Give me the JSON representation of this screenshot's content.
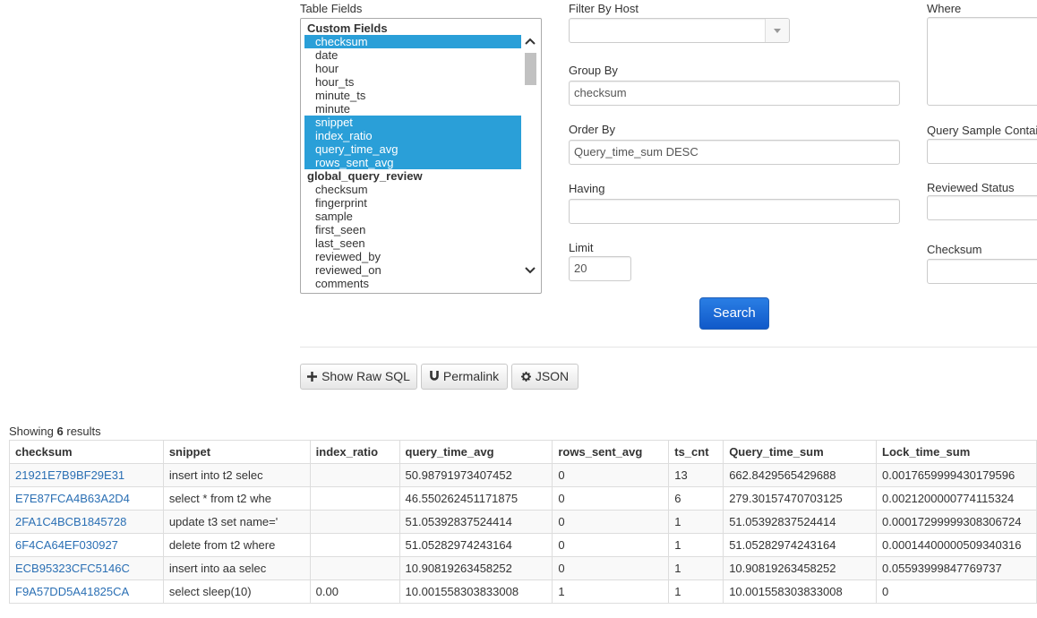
{
  "labels": {
    "table_fields": "Table Fields",
    "filter_by_host": "Filter By Host",
    "where": "Where",
    "group_by": "Group By",
    "order_by": "Order By",
    "having": "Having",
    "limit": "Limit",
    "query_sample_contains": "Query Sample Contai",
    "reviewed_status": "Reviewed Status",
    "checksum": "Checksum"
  },
  "inputs": {
    "filter_by_host": "",
    "where": "",
    "group_by": "checksum",
    "order_by": "Query_time_sum DESC",
    "having": "",
    "limit": "20",
    "query_sample_contains": "",
    "reviewed_status": "",
    "checksum": ""
  },
  "fields_list": {
    "groups": [
      {
        "name": "Custom Fields",
        "options": [
          {
            "label": "checksum",
            "selected": true
          },
          {
            "label": "date",
            "selected": false
          },
          {
            "label": "hour",
            "selected": false
          },
          {
            "label": "hour_ts",
            "selected": false
          },
          {
            "label": "minute_ts",
            "selected": false
          },
          {
            "label": "minute",
            "selected": false
          },
          {
            "label": "snippet",
            "selected": true
          },
          {
            "label": "index_ratio",
            "selected": true
          },
          {
            "label": "query_time_avg",
            "selected": true
          },
          {
            "label": "rows_sent_avg",
            "selected": true
          }
        ]
      },
      {
        "name": "global_query_review",
        "options": [
          {
            "label": "checksum",
            "selected": false
          },
          {
            "label": "fingerprint",
            "selected": false
          },
          {
            "label": "sample",
            "selected": false
          },
          {
            "label": "first_seen",
            "selected": false
          },
          {
            "label": "last_seen",
            "selected": false
          },
          {
            "label": "reviewed_by",
            "selected": false
          },
          {
            "label": "reviewed_on",
            "selected": false
          },
          {
            "label": "comments",
            "selected": false
          }
        ]
      }
    ]
  },
  "buttons": {
    "search": "Search",
    "show_raw_sql": "Show Raw SQL",
    "permalink": "Permalink",
    "json": "JSON"
  },
  "results": {
    "showing_prefix": "Showing",
    "count": "6",
    "showing_suffix": "results",
    "columns": [
      "checksum",
      "snippet",
      "index_ratio",
      "query_time_avg",
      "rows_sent_avg",
      "ts_cnt",
      "Query_time_sum",
      "Lock_time_sum"
    ],
    "rows": [
      [
        "21921E7B9BF29E31",
        "insert into t2 selec",
        "",
        "50.98791973407452",
        "0",
        "13",
        "662.8429565429688",
        "0.0017659999430179596"
      ],
      [
        "E7E87FCA4B63A2D4",
        "select * from t2 whe",
        "",
        "46.550262451171875",
        "0",
        "6",
        "279.30157470703125",
        "0.0021200000774115324"
      ],
      [
        "2FA1C4BCB1845728",
        "update t3 set name='",
        "",
        "51.05392837524414",
        "0",
        "1",
        "51.05392837524414",
        "0.00017299999308306724"
      ],
      [
        "6F4CA64EF030927",
        "delete from t2 where",
        "",
        "51.05282974243164",
        "0",
        "1",
        "51.05282974243164",
        "0.00014400000509340316"
      ],
      [
        "ECB95323CFC5146C",
        "insert into aa selec",
        "",
        "10.90819263458252",
        "0",
        "1",
        "10.90819263458252",
        "0.05593999847769737"
      ],
      [
        "F9A57DD5A41825CA",
        "select sleep(10)",
        "0.00",
        "10.001558303833008",
        "1",
        "1",
        "10.001558303833008",
        "0"
      ]
    ]
  },
  "colors": {
    "selection": "#2a9fd8",
    "primary_button": "#1a6fd6",
    "link": "#2a6fb4"
  }
}
